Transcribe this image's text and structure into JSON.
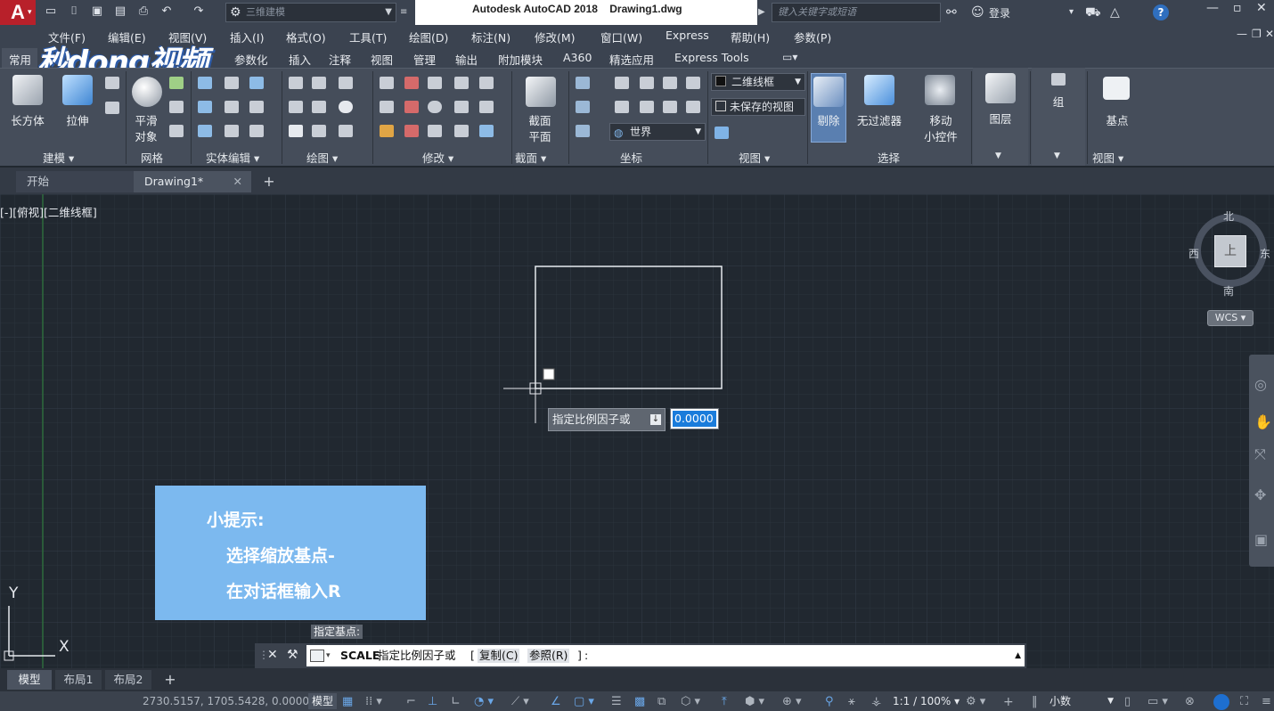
{
  "titlebar": {
    "logo": "A",
    "workspace": "三维建模",
    "app_title": "Autodesk AutoCAD 2018",
    "file_title": "Drawing1.dwg",
    "search_placeholder": "键入关键字或短语",
    "login": "登录"
  },
  "menubar": [
    "文件(F)",
    "编辑(E)",
    "视图(V)",
    "插入(I)",
    "格式(O)",
    "工具(T)",
    "绘图(D)",
    "标注(N)",
    "修改(M)",
    "窗口(W)",
    "Express",
    "帮助(H)",
    "参数(P)"
  ],
  "ribbon_tabs": [
    "常用",
    "参数化",
    "插入",
    "注释",
    "视图",
    "管理",
    "输出",
    "附加模块",
    "A360",
    "精选应用",
    "Express Tools"
  ],
  "watermark": "秒dong视频",
  "ribbon": {
    "big_buttons": {
      "box": "长方体",
      "extrude": "拉伸",
      "smooth_1": "平滑",
      "smooth_2": "对象",
      "section_1": "截面",
      "section_2": "平面",
      "cull": "剔除",
      "no_filter": "无过滤器",
      "gizmo_1": "移动",
      "gizmo_2": "小控件",
      "layers": "图层",
      "group": "组",
      "base": "基点"
    },
    "dropdowns": {
      "visual_style": "二维线框",
      "view_name": "未保存的视图",
      "ucs": "世界"
    },
    "panels": [
      "建模",
      "网格",
      "实体编辑",
      "绘图",
      "修改",
      "截面",
      "坐标",
      "视图",
      "选择",
      "视图"
    ]
  },
  "file_tabs": {
    "start": "开始",
    "drawing": "Drawing1*"
  },
  "viewport": {
    "label": "[-][俯视][二维线框]",
    "compass": {
      "n": "北",
      "s": "南",
      "w": "西",
      "e": "东",
      "top": "上"
    },
    "wcs": "WCS",
    "ucs_y": "Y",
    "ucs_x": "X"
  },
  "dynamic_input": {
    "prompt": "指定比例因子或",
    "value": "0.0000",
    "base_tooltip": "指定基点:"
  },
  "hint": {
    "title": "小提示:",
    "line1": "选择缩放基点-",
    "line2": "在对话框输入R"
  },
  "command": {
    "name": "SCALE",
    "prompt": "指定比例因子或",
    "opt_copy": "复制(C)",
    "opt_ref": "参照(R)",
    "tail": ":"
  },
  "layout_tabs": [
    "模型",
    "布局1",
    "布局2"
  ],
  "status": {
    "coords": "2730.5157, 1705.5428, 0.0000",
    "model": "模型",
    "scale": "1:1 / 100%",
    "units": "小数"
  },
  "colors": {
    "canvas": "#212830",
    "ribbon": "#454d5a",
    "hint": "#7cb9ef",
    "accent": "#1a7cdb"
  }
}
